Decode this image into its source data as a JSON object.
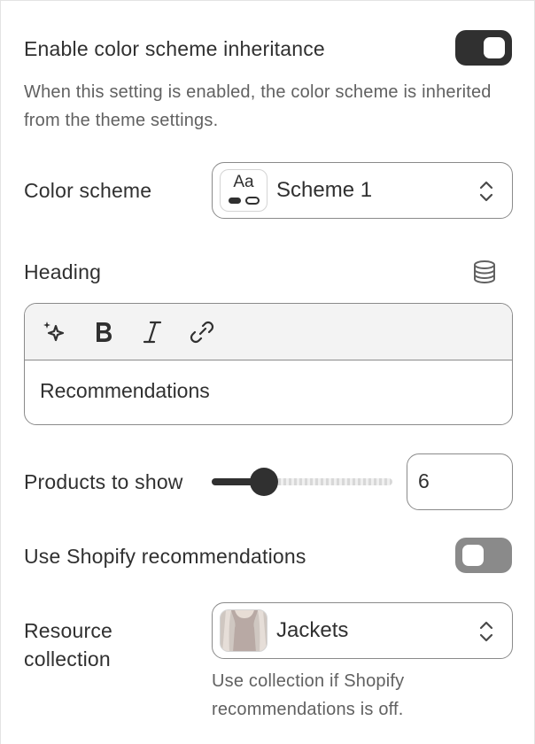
{
  "inheritance": {
    "label": "Enable color scheme inheritance",
    "enabled": true,
    "help": "When this setting is enabled, the color scheme is inherited from the theme settings."
  },
  "color_scheme": {
    "label": "Color scheme",
    "thumb_text": "Aa",
    "value": "Scheme 1",
    "icon": "chevron-up-down-icon"
  },
  "heading": {
    "label": "Heading",
    "source_icon": "database-icon",
    "toolbar": [
      "sparkle-icon",
      "bold-icon",
      "italic-icon",
      "link-icon"
    ],
    "value": "Recommendations"
  },
  "products_to_show": {
    "label": "Products to show",
    "value": "6",
    "level_fraction": 0.29
  },
  "shopify_recommendations": {
    "label": "Use Shopify recommendations",
    "enabled": false
  },
  "resource_collection": {
    "label_line1": "Resource",
    "label_line2": "collection",
    "value": "Jackets",
    "help_line1": "Use collection if Shopify",
    "help_line2": "recommendations is off."
  },
  "colors": {
    "text": "#303030",
    "subdued": "#616161",
    "toggle_on": "#303030",
    "toggle_off": "#8a8a8a",
    "border": "#8a8a8a"
  }
}
